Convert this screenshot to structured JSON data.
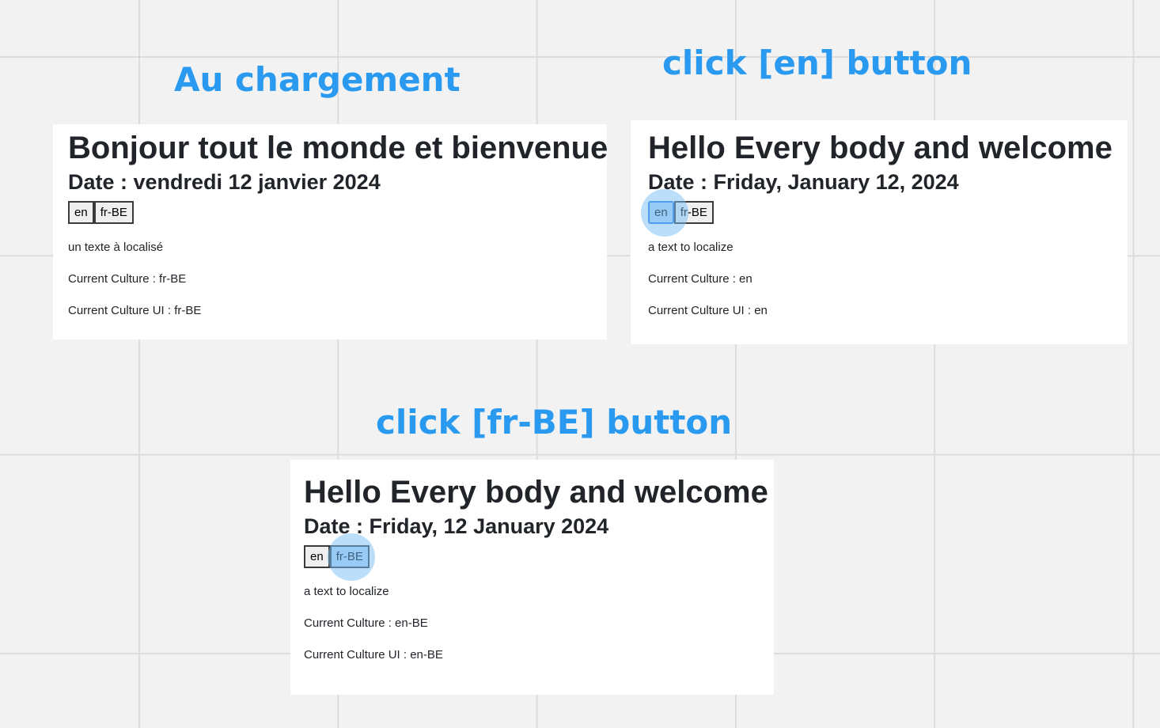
{
  "captions": {
    "load": "Au chargement",
    "click_en": "click [en] button",
    "click_frbe": "click [fr-BE] button"
  },
  "panels": [
    {
      "title": "Bonjour tout le monde et bienvenue",
      "date": "Date : vendredi 12 janvier 2024",
      "btn_en": "en",
      "btn_frbe": "fr-BE",
      "text": "un texte à localisé",
      "culture": "Current Culture : fr-BE",
      "culture_ui": "Current Culture UI : fr-BE"
    },
    {
      "title": "Hello Every body and welcome",
      "date": "Date : Friday, January 12, 2024",
      "btn_en": "en",
      "btn_frbe": "fr-BE",
      "text": "a text to localize",
      "culture": "Current Culture : en",
      "culture_ui": "Current Culture UI : en"
    },
    {
      "title": "Hello Every body and welcome",
      "date": "Date : Friday, 12 January 2024",
      "btn_en": "en",
      "btn_frbe": "fr-BE",
      "text": "a text to localize",
      "culture": "Current Culture : en-BE",
      "culture_ui": "Current Culture UI : en-BE"
    }
  ],
  "colors": {
    "caption": "#2a9af0",
    "focus": "#b7d8f5"
  }
}
